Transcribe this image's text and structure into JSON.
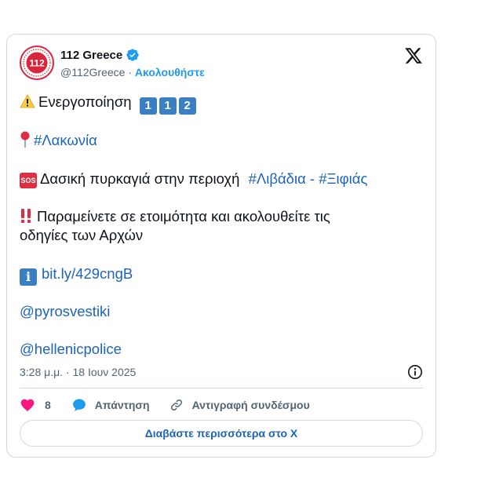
{
  "account": {
    "name": "112 Greece",
    "handle": "@112Greece",
    "separator": " · ",
    "follow_label": "Ακολουθήστε",
    "avatar_text": "112"
  },
  "tweet": {
    "line1_text": "Ενεργοποίηση",
    "line1_digits": [
      "1",
      "1",
      "2"
    ],
    "line2_tag": "#Λακωνία",
    "line3_text": "Δασική πυρκαγιά στην περιοχή",
    "line3_tag1": "#Λιβάδια",
    "line3_sep": " - ",
    "line3_tag2": "#Ξιφιάς",
    "line4a": "Παραμείνετε σε ετοιμότητα και ακολουθείτε τις",
    "line4b": "οδηγίες των Αρχών",
    "link": "bit.ly/429cngB",
    "mention1": "@pyrosvestiki",
    "mention2": "@hellenicpolice",
    "sos_badge": "SOS",
    "info_badge": "i"
  },
  "meta": {
    "timestamp": "3:28 μ.μ. · 18 Ιουν 2025"
  },
  "actions": {
    "like_count": "8",
    "reply_label": "Απάντηση",
    "copy_label": "Αντιγραφή συνδέσμου"
  },
  "readmore": {
    "label": "Διαβάστε περισσότερα στο X"
  },
  "colors": {
    "accent": "#1d9bf0",
    "link": "#1d63b8",
    "like": "#f91880",
    "avatar_red": "#d7263d",
    "keycap": "#3a7fc1"
  }
}
